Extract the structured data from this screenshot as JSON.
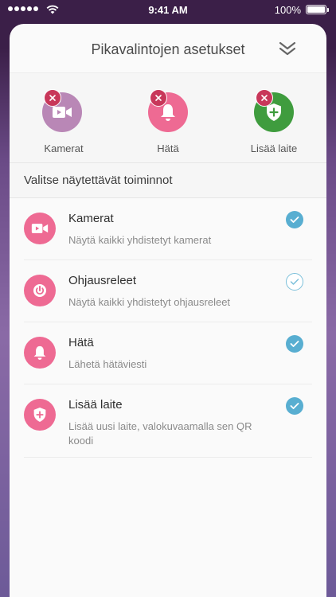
{
  "status_bar": {
    "time": "9:41 AM",
    "battery": "100%",
    "signal_icon": "signal-dots-icon",
    "wifi_icon": "wifi-icon",
    "battery_icon": "battery-icon"
  },
  "sheet": {
    "title": "Pikavalintojen asetukset",
    "collapse_icon": "double-chevron-down-icon"
  },
  "quick_actions": [
    {
      "label": "Kamerat",
      "icon": "video-camera-icon",
      "color": "#b987b6"
    },
    {
      "label": "Hätä",
      "icon": "bell-icon",
      "color": "#ee6a93"
    },
    {
      "label": "Lisää laite",
      "icon": "shield-plus-icon",
      "color": "#3f9c3e"
    }
  ],
  "remove_badge_color": "#c8375a",
  "section": {
    "title": "Valitse näytettävät toiminnot"
  },
  "functions": [
    {
      "title": "Kamerat",
      "description": "Näytä kaikki yhdistetyt kamerat",
      "icon": "video-camera-icon",
      "checked": true
    },
    {
      "title": "Ohjausreleet",
      "description": "Näytä kaikki yhdistetyt ohjausreleet",
      "icon": "power-icon",
      "checked": false
    },
    {
      "title": "Hätä",
      "description": "Lähetä hätäviesti",
      "icon": "bell-icon",
      "checked": true
    },
    {
      "title": "Lisää laite",
      "description": "Lisää uusi laite, valokuvaamalla sen QR koodi",
      "icon": "shield-plus-icon",
      "checked": true
    }
  ],
  "colors": {
    "accent_pink": "#ee6a93",
    "check_blue": "#58aed1"
  }
}
